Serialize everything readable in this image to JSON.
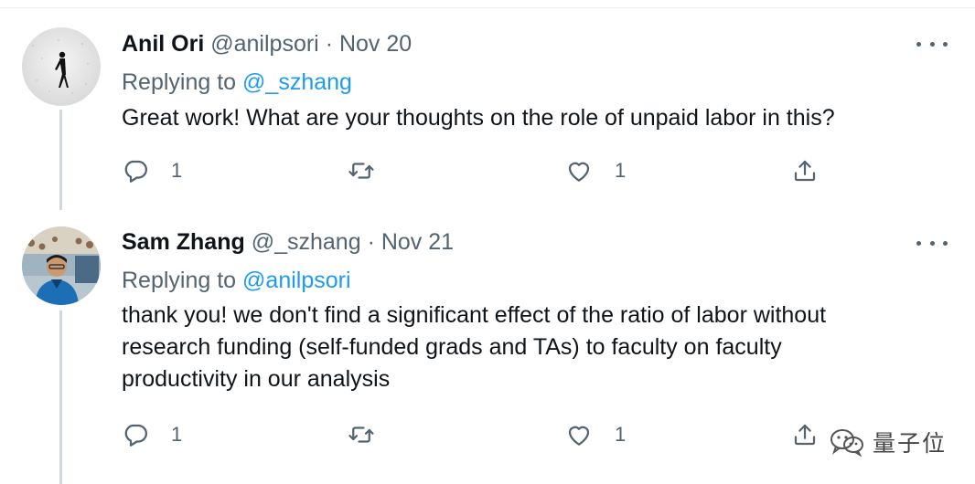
{
  "tweets": [
    {
      "name": "Anil Ori",
      "handle": "@anilpsori",
      "separator": "·",
      "date": "Nov 20",
      "replying_prefix": "Replying to",
      "replying_to": "@_szhang",
      "text": [
        "Great work! What are your thoughts on the role of unpaid labor in this?"
      ],
      "replies": "1",
      "likes": "1",
      "avatar_icon": "avatar-walking-figure"
    },
    {
      "name": "Sam Zhang",
      "handle": "@_szhang",
      "separator": "·",
      "date": "Nov 21",
      "replying_prefix": "Replying to",
      "replying_to": "@anilpsori",
      "text": [
        "thank you! we don't find a significant effect of the ratio of labor without",
        "research funding (self-funded grads and TAs) to faculty on faculty",
        "productivity in our analysis"
      ],
      "replies": "1",
      "likes": "1",
      "avatar_icon": "avatar-photo-person"
    }
  ],
  "watermark": {
    "text": "量子位",
    "icon": "wechat-icon"
  },
  "colors": {
    "accent": "#1d9bf0",
    "secondary_text": "#536471",
    "thread_line": "#cfd9de"
  }
}
